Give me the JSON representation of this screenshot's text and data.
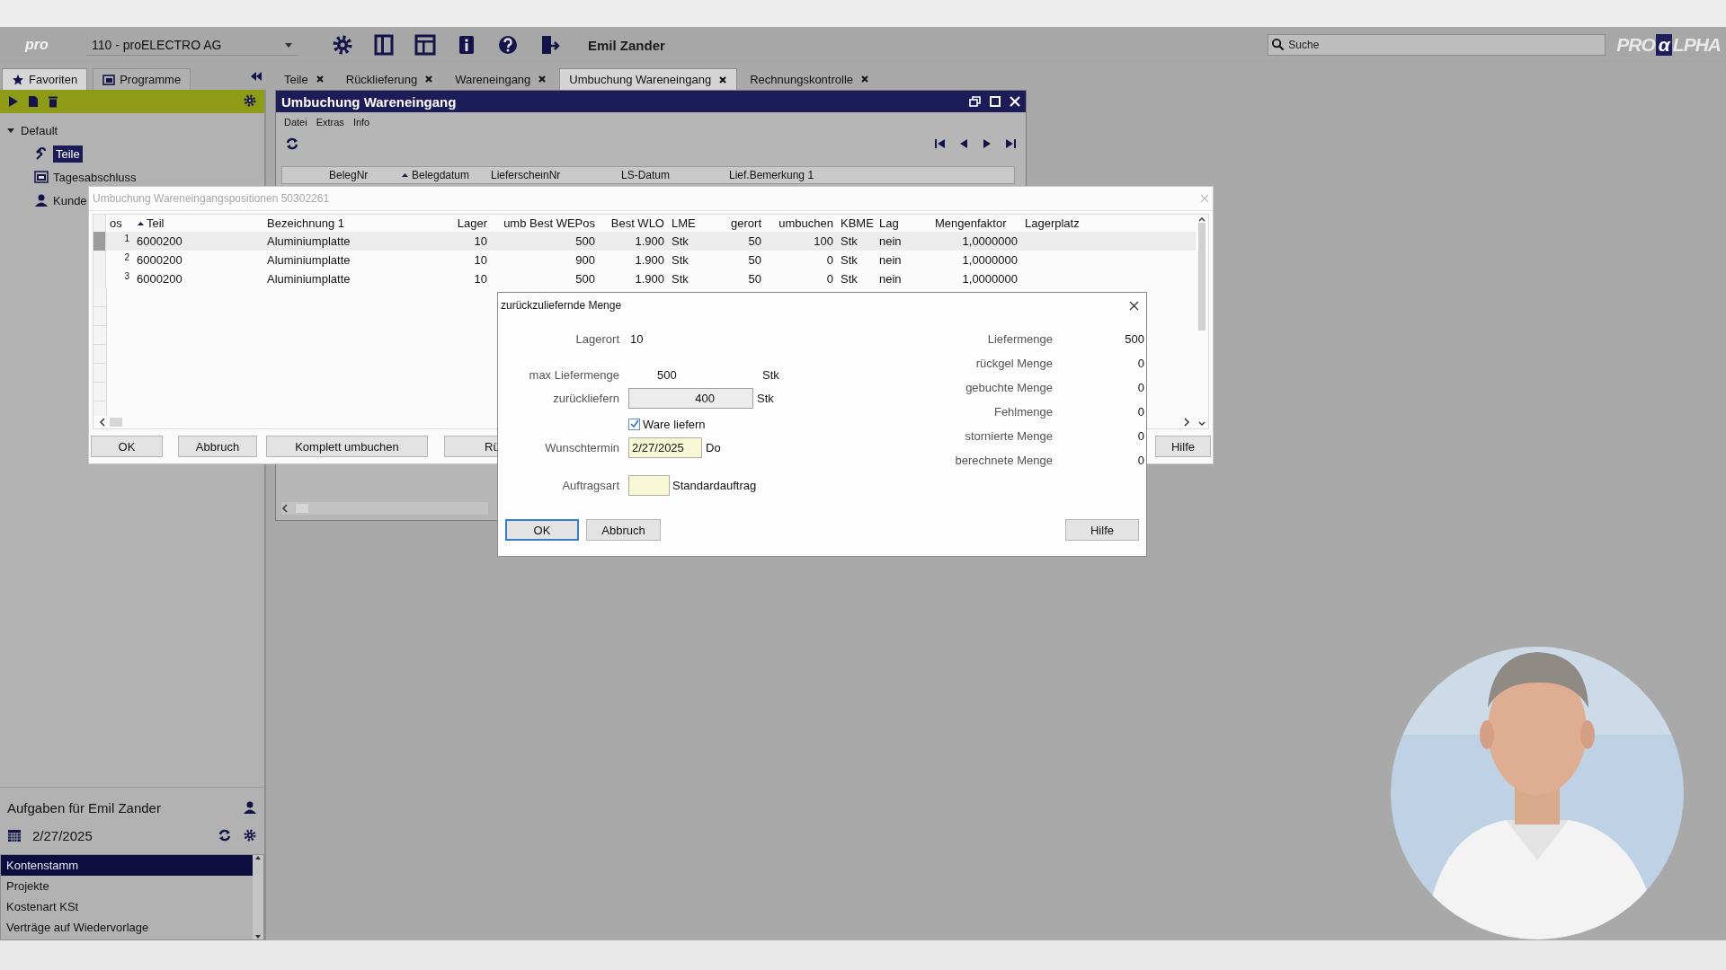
{
  "app_bar": {
    "logo": "pro",
    "company": "110 - proELECTRO AG",
    "user": "Emil Zander",
    "search": {
      "placeholder": "Suche"
    },
    "brand": [
      "PRO",
      "α",
      "LPHA"
    ]
  },
  "panel_tabs": [
    {
      "label": "Favoriten",
      "selected": true
    },
    {
      "label": "Programme",
      "selected": false
    }
  ],
  "doc_tabs": [
    {
      "label": "Teile",
      "selected": false
    },
    {
      "label": "Rücklieferung",
      "selected": false
    },
    {
      "label": "Wareneingang",
      "selected": false
    },
    {
      "label": "Umbuchung Wareneingang",
      "selected": true
    },
    {
      "label": "Rechnungskontrolle",
      "selected": false
    }
  ],
  "tree": [
    {
      "label": "Default",
      "expanded": true,
      "children": [
        {
          "label": "Teile",
          "kind": "part",
          "selected": true
        },
        {
          "label": "Tagesabschluss",
          "kind": "report",
          "selected": false
        },
        {
          "label": "Kunde",
          "kind": "person",
          "selected": false
        }
      ]
    }
  ],
  "tasks": {
    "title": "Aufgaben für Emil Zander",
    "date": "2/27/2025",
    "items": [
      {
        "label": "Kontenstamm",
        "selected": true
      },
      {
        "label": "Projekte",
        "selected": false
      },
      {
        "label": "Kostenart KSt",
        "selected": false
      },
      {
        "label": "Verträge auf Wiedervorlage",
        "selected": false
      }
    ]
  },
  "main_window": {
    "title": "Umbuchung Wareneingang",
    "menu": [
      "Datei",
      "Extras",
      "Info"
    ],
    "columns": [
      {
        "label": "BelegNr",
        "sorted": false
      },
      {
        "label": "Belegdatum",
        "sorted": true
      },
      {
        "label": "LieferscheinNr",
        "sorted": false
      },
      {
        "label": "LS-Datum",
        "sorted": false
      },
      {
        "label": "Lief.Bemerkung 1",
        "sorted": false
      }
    ]
  },
  "positions_dialog": {
    "title": "Umbuchung Wareneingangspositionen 50302261",
    "columns": [
      {
        "label": "os",
        "sorted": false
      },
      {
        "label": "Teil",
        "sorted": true
      },
      {
        "label": "Bezeichnung 1",
        "sorted": false
      },
      {
        "label": "Lager",
        "sorted": false
      },
      {
        "label": "umb Best WEPos",
        "sorted": false
      },
      {
        "label": "Best WLO",
        "sorted": false
      },
      {
        "label": "LME",
        "sorted": false
      },
      {
        "label": "gerort",
        "sorted": false
      },
      {
        "label": "umbuchen",
        "sorted": false
      },
      {
        "label": "KBME",
        "sorted": false
      },
      {
        "label": "Lag",
        "sorted": false
      },
      {
        "label": "Mengenfaktor",
        "sorted": false
      },
      {
        "label": "Lagerplatz",
        "sorted": false
      }
    ],
    "rows": [
      {
        "selected": true,
        "cells": [
          "1",
          "6000200",
          "Aluminiumplatte",
          "10",
          "500",
          "1.900",
          "Stk",
          "50",
          "100",
          "Stk",
          "nein",
          "1,0000000"
        ]
      },
      {
        "selected": false,
        "cells": [
          "2",
          "6000200",
          "Aluminiumplatte",
          "10",
          "900",
          "1.900",
          "Stk",
          "50",
          "0",
          "Stk",
          "nein",
          "1,0000000"
        ]
      },
      {
        "selected": false,
        "cells": [
          "3",
          "6000200",
          "Aluminiumplatte",
          "10",
          "500",
          "1.900",
          "Stk",
          "50",
          "0",
          "Stk",
          "nein",
          "1,0000000"
        ]
      }
    ],
    "buttons": [
      "OK",
      "Abbruch",
      "Komplett umbuchen",
      "Rü",
      "Hilfe"
    ]
  },
  "quantity_dialog": {
    "title": "zurückzuliefernde Menge",
    "lagerort": {
      "label": "Lagerort",
      "value": "10"
    },
    "max_quantity": {
      "label": "max Liefermenge",
      "value": "500",
      "unit": "Stk"
    },
    "return_quantity": {
      "label": "zurückliefern",
      "value": "400",
      "unit": "Stk"
    },
    "deliver_goods": {
      "label": "Ware liefern",
      "checked": true
    },
    "desired_date": {
      "label": "Wunschtermin",
      "value": "2/27/2025",
      "weekday": "Do"
    },
    "order_type": {
      "label": "Auftragsart",
      "description": "Standardauftrag"
    },
    "summary": [
      {
        "label": "Liefermenge",
        "value": "500"
      },
      {
        "label": "rückgel Menge",
        "value": "0"
      },
      {
        "label": "gebuchte Menge",
        "value": "0"
      },
      {
        "label": "Fehlmenge",
        "value": "0"
      },
      {
        "label": "stornierte Menge",
        "value": "0"
      },
      {
        "label": "berechnete Menge",
        "value": "0"
      }
    ],
    "buttons": [
      "OK",
      "Abbruch",
      "Hilfe"
    ]
  }
}
